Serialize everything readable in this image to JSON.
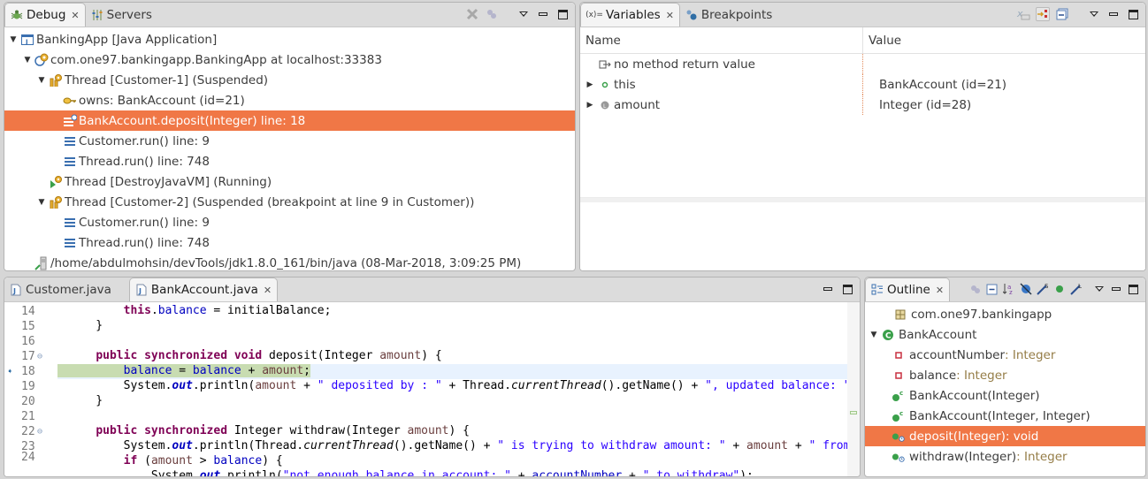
{
  "debug_panel": {
    "tabs": [
      {
        "label": "Debug",
        "icon": "bug-icon",
        "active": true,
        "closable": true
      },
      {
        "label": "Servers",
        "icon": "servers-icon",
        "active": false
      }
    ],
    "tree": [
      {
        "level": 0,
        "expanded": true,
        "icon": "java-app-icon",
        "label": "BankingApp [Java Application]"
      },
      {
        "level": 1,
        "expanded": true,
        "icon": "debug-target-icon",
        "label": "com.one97.bankingapp.BankingApp at localhost:33383"
      },
      {
        "level": 2,
        "expanded": true,
        "icon": "thread-suspended-icon",
        "label": "Thread [Customer-1] (Suspended)"
      },
      {
        "level": 3,
        "icon": "monitor-key-icon",
        "label": "owns: BankAccount  (id=21)"
      },
      {
        "level": 3,
        "icon": "stack-frame-sync-icon",
        "label": "BankAccount.deposit(Integer) line: 18",
        "selected": true
      },
      {
        "level": 3,
        "icon": "stack-frame-icon",
        "label": "Customer.run() line: 9"
      },
      {
        "level": 3,
        "icon": "stack-frame-icon",
        "label": "Thread.run() line: 748"
      },
      {
        "level": 2,
        "icon": "thread-running-icon",
        "label": "Thread [DestroyJavaVM] (Running)"
      },
      {
        "level": 2,
        "expanded": true,
        "icon": "thread-suspended-icon",
        "label": "Thread [Customer-2] (Suspended (breakpoint at line 9 in Customer))"
      },
      {
        "level": 3,
        "icon": "stack-frame-icon",
        "label": "Customer.run() line: 9"
      },
      {
        "level": 3,
        "icon": "stack-frame-icon",
        "label": "Thread.run() line: 748"
      },
      {
        "level": 1,
        "icon": "process-icon",
        "label": "/home/abdulmohsin/devTools/jdk1.8.0_161/bin/java (08-Mar-2018, 3:09:25 PM)"
      }
    ]
  },
  "variables_panel": {
    "tabs": [
      {
        "label": "Variables",
        "icon": "variables-icon",
        "active": true,
        "closable": true
      },
      {
        "label": "Breakpoints",
        "icon": "breakpoints-icon",
        "active": false
      }
    ],
    "columns": [
      "Name",
      "Value"
    ],
    "rows": [
      {
        "name": "no method return value",
        "value": "",
        "icon": "return-value-icon",
        "expandable": false
      },
      {
        "name": "this",
        "value": "BankAccount  (id=21)",
        "icon": "field-icon",
        "expandable": true
      },
      {
        "name": "amount",
        "value": "Integer  (id=28)",
        "icon": "local-variable-icon",
        "expandable": true
      }
    ]
  },
  "editor": {
    "tabs": [
      {
        "label": "Customer.java",
        "active": false
      },
      {
        "label": "BankAccount.java",
        "active": true,
        "closable": true
      }
    ],
    "current_line": 18,
    "lines": [
      14,
      15,
      16,
      17,
      18,
      19,
      20,
      21,
      22,
      23,
      24
    ]
  },
  "outline_panel": {
    "tab": {
      "label": "Outline",
      "icon": "outline-icon",
      "closable": true
    },
    "items": [
      {
        "level": 0,
        "icon": "package-icon",
        "label": "com.one97.bankingapp",
        "type": ""
      },
      {
        "level": 0,
        "icon": "class-icon",
        "label": "BankAccount",
        "type": "",
        "expanded": true
      },
      {
        "level": 1,
        "icon": "private-field-icon",
        "label": "accountNumber",
        "type": " : Integer"
      },
      {
        "level": 1,
        "icon": "private-field-icon",
        "label": "balance",
        "type": " : Integer"
      },
      {
        "level": 1,
        "icon": "constructor-icon",
        "label": "BankAccount(Integer)",
        "type": ""
      },
      {
        "level": 1,
        "icon": "constructor-icon",
        "label": "BankAccount(Integer, Integer)",
        "type": ""
      },
      {
        "level": 1,
        "icon": "sync-method-icon",
        "label": "deposit(Integer)",
        "type": " : void",
        "selected": true
      },
      {
        "level": 1,
        "icon": "sync-method-icon",
        "label": "withdraw(Integer)",
        "type": " : Integer"
      }
    ]
  },
  "colors": {
    "selection": "#f07746",
    "debug_line": "#c8dcb1",
    "keyword": "#7f0055",
    "string": "#2a00ff",
    "field": "#0000c0"
  }
}
